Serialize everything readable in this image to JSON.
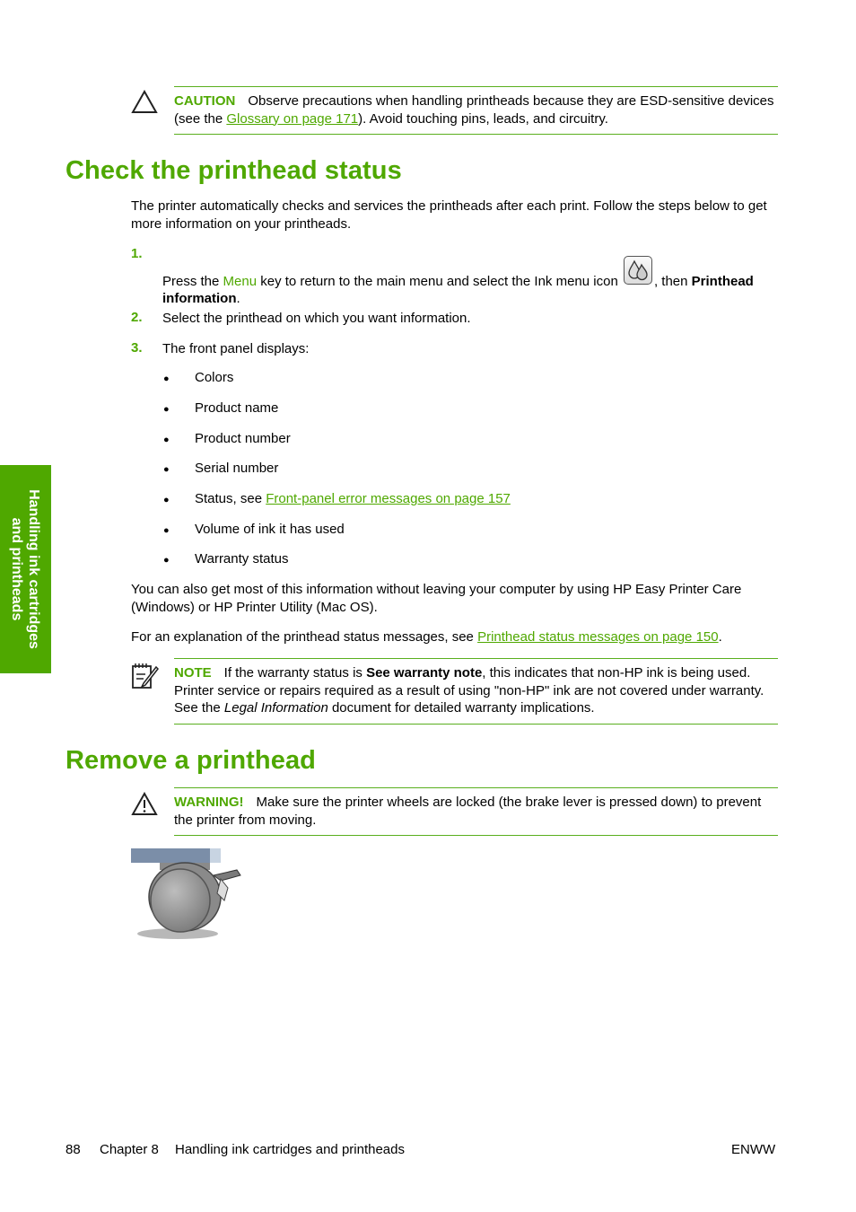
{
  "caution": {
    "tag": "CAUTION",
    "text_before": "Observe precautions when handling printheads because they are ESD-sensitive devices (see the ",
    "link": "Glossary on page 171",
    "text_after": "). Avoid touching pins, leads, and circuitry.",
    "icon": "caution-triangle-icon"
  },
  "section1": {
    "title": "Check the printhead status",
    "intro": "The printer automatically checks and services the printheads after each print. Follow the steps below to get more information on your printheads.",
    "steps": [
      {
        "num": "1.",
        "text_a": "Press the ",
        "menu_word": "Menu",
        "text_b": " key to return to the main menu and select the Ink menu icon ",
        "icon": "ink-drops-icon",
        "text_c": ", then ",
        "bold": "Printhead information",
        "text_d": "."
      },
      {
        "num": "2.",
        "text": "Select the printhead on which you want information."
      },
      {
        "num": "3.",
        "text": "The front panel displays:"
      }
    ],
    "bullets": [
      {
        "text": "Colors"
      },
      {
        "text": "Product name"
      },
      {
        "text": "Product number"
      },
      {
        "text": "Serial number"
      },
      {
        "text": "Status, see ",
        "link": "Front-panel error messages on page 157"
      },
      {
        "text": "Volume of ink it has used"
      },
      {
        "text": "Warranty status"
      }
    ],
    "para_also": "You can also get most of this information without leaving your computer by using HP Easy Printer Care (Windows) or HP Printer Utility (Mac OS).",
    "para_expl": {
      "text": "For an explanation of the printhead status messages, see ",
      "link": "Printhead status messages on page 150",
      "end": "."
    },
    "note": {
      "tag": "NOTE",
      "text_a": "If the warranty status is ",
      "bold": "See warranty note",
      "text_b": ", this indicates that non-HP ink is being used. Printer service or repairs required as a result of using \"non-HP\" ink are not covered under warranty. See the ",
      "italic": "Legal Information",
      "text_c": " document for detailed warranty implications.",
      "icon": "note-pad-icon"
    }
  },
  "section2": {
    "title": "Remove a printhead",
    "warning": {
      "tag": "WARNING!",
      "text": "Make sure the printer wheels are locked (the brake lever is pressed down) to prevent the printer from moving.",
      "icon": "warning-triangle-icon"
    },
    "image": "printer-wheel-brake-illustration"
  },
  "side_tab": {
    "line1": "Handling ink cartridges",
    "line2": "and printheads"
  },
  "footer": {
    "page": "88",
    "chapter": "Chapter 8",
    "chapter_title": "Handling ink cartridges and printheads",
    "right": "ENWW"
  }
}
